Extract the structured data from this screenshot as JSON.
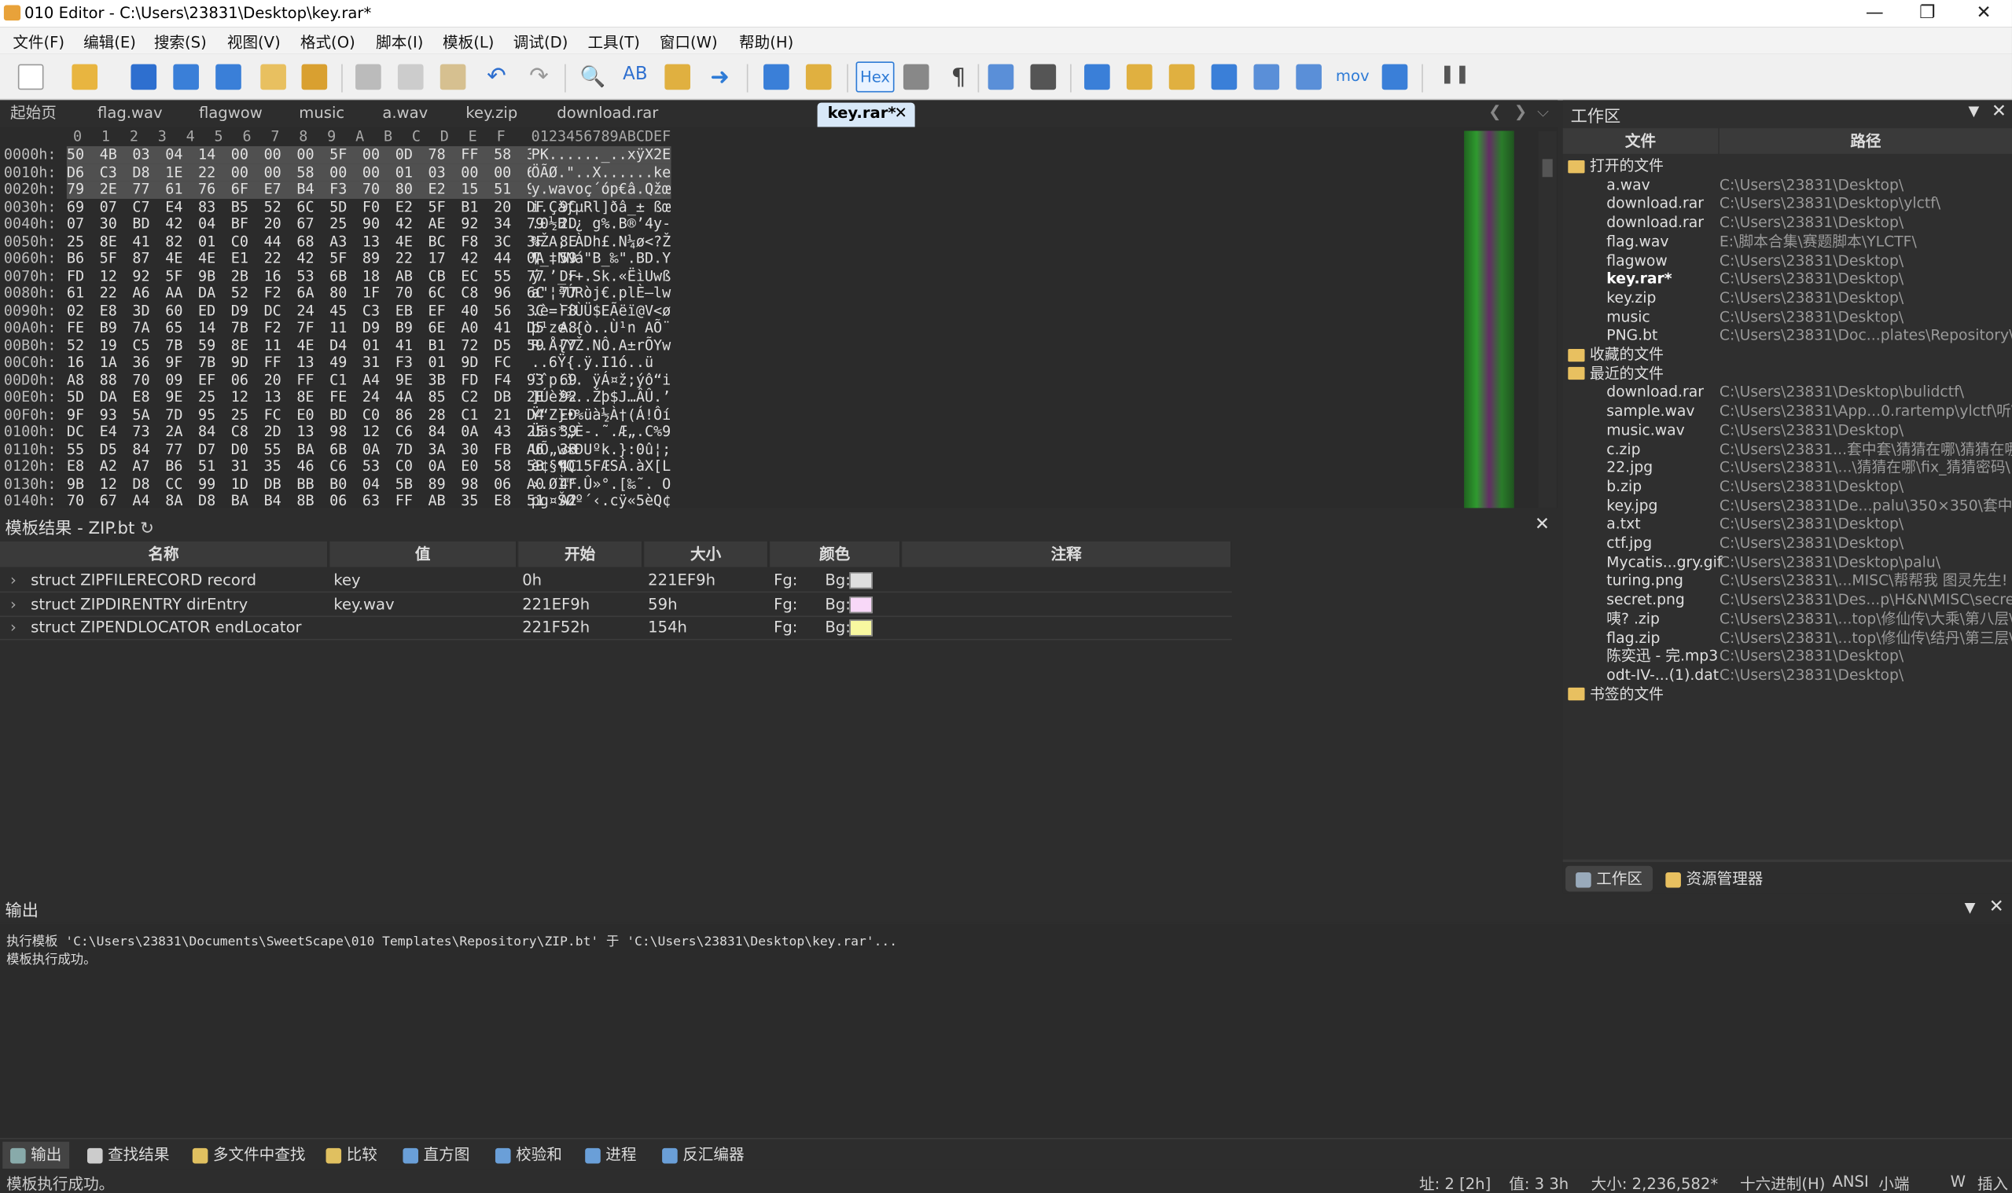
{
  "window": {
    "title": "010 Editor - C:\\Users\\23831\\Desktop\\key.rar*"
  },
  "menu": [
    "文件(F)",
    "编辑(E)",
    "搜索(S)",
    "视图(V)",
    "格式(O)",
    "脚本(I)",
    "模板(L)",
    "调试(D)",
    "工具(T)",
    "窗口(W)",
    "帮助(H)"
  ],
  "toolbar": {
    "hex_label": "Hex",
    "mov_label": "mov",
    "icons": [
      "new-file-icon",
      "open-file-icon",
      "save-icon",
      "save-as-icon",
      "save-all-icon",
      "open-folder-icon",
      "workspace-icon",
      "cut-icon",
      "copy-icon",
      "paste-icon",
      "undo-icon",
      "redo-icon",
      "find-icon",
      "replace-icon",
      "find-in-files-icon",
      "goto-icon",
      "run-script-icon",
      "run-template-icon",
      "hex-mode-icon",
      "text-mode-icon",
      "paragraph-icon",
      "columns-icon",
      "highlight-icon",
      "calculator-icon",
      "inspector-icon",
      "compare-icon",
      "histogram-icon",
      "checksum-icon",
      "checksum-ok-icon",
      "disassembler-icon",
      "base-convert-icon",
      "pause-icon"
    ]
  },
  "tabs": [
    "起始页",
    "flag.wav",
    "flagwow",
    "music",
    "a.wav",
    "key.zip",
    "download.rar",
    "key.rar*"
  ],
  "hex": {
    "header_cols": [
      "0",
      "1",
      "2",
      "3",
      "4",
      "5",
      "6",
      "7",
      "8",
      "9",
      "A",
      "B",
      "C",
      "D",
      "E",
      "F"
    ],
    "ascii_header": "0123456789ABCDEF",
    "rows": [
      {
        "off": "0000h:",
        "bytes": "50 4B 03 04 14 00 00 00 5F 00 0D 78 FF 58 32 45",
        "ascii": "PK......_..xÿX2E"
      },
      {
        "off": "0010h:",
        "bytes": "D6 C3 D8 1E 22 00 00 58 00 00 01 03 00 00 6B 65",
        "ascii": "ÖÃØ.\"..X......ke"
      },
      {
        "off": "0020h:",
        "bytes": "79 2E 77 61 76 6F E7 B4 F3 70 80 E2 15 51 9E 9C",
        "ascii": "y.wavoç´óp€â.Qžœ"
      },
      {
        "off": "0030h:",
        "bytes": "69 07 C7 E4 83 B5 52 6C 5D F0 E2 5F B1 20 DF 9C",
        "ascii": "i.ÇäƒµRl]ðâ_± ßœ"
      },
      {
        "off": "0040h:",
        "bytes": "07 30 BD 42 04 BF 20 67 25 90 42 AE 92 34 79 2D",
        "ascii": ".0½B.¿ g%.B®’4y-"
      },
      {
        "off": "0050h:",
        "bytes": "25 8E 41 82 01 C0 44 68 A3 13 4E BC F8 3C 3F 8E",
        "ascii": "%ŽA‚.ÀDh£.N¼ø<?Ž"
      },
      {
        "off": "0060h:",
        "bytes": "B6 5F 87 4E 4E E1 22 42 5F 89 22 17 42 44 0A 59",
        "ascii": "¶_‡NNá\"B_‰\".BD.Y"
      },
      {
        "off": "0070h:",
        "bytes": "FD 12 92 5F 9B 2B 16 53 6B 18 AB CB EC 55 77 DF",
        "ascii": "ý.’_›+.Sk.«ËìUwß"
      },
      {
        "off": "0080h:",
        "bytes": "61 22 A6 AA DA 52 F2 6A 80 1F 70 6C C8 96 6C 77",
        "ascii": "a\"¦ªÚRòj€.plÈ–lw"
      },
      {
        "off": "0090h:",
        "bytes": "02 E8 3D 60 ED D9 DC 24 45 C3 EB EF 40 56 3C F8",
        "ascii": ".è=`íÙÜ$EÃëï@V<ø"
      },
      {
        "off": "00A0h:",
        "bytes": "FE B9 7A 65 14 7B F2 7F 11 D9 B9 6E A0 41 D5 A8",
        "ascii": "þ¹ze.{ò..Ù¹n AÕ¨"
      },
      {
        "off": "00B0h:",
        "bytes": "52 19 C5 7B 59 8E 11 4E D4 01 41 B1 72 D5 59 77",
        "ascii": "R.Å{YŽ.NÔ.A±rÕYw"
      },
      {
        "off": "00C0h:",
        "bytes": "16 1A 36 9F 7B 9D FF 13 49 31 F3 01 9D FC",
        "ascii": "..6Ÿ{.ÿ.I1ó..ü"
      },
      {
        "off": "00D0h:",
        "bytes": "A8 88 70 09 EF 06 20 FF C1 A4 9E 3B FD F4 93 69",
        "ascii": "¨ˆp.ï. ÿÁ¤ž;ýô“i"
      },
      {
        "off": "00E0h:",
        "bytes": "5D DA E8 9E 25 12 13 8E FE 24 4A 85 C2 DB 2E 92",
        "ascii": "]Úèž%..Žþ$J…ÂÛ.’"
      },
      {
        "off": "00F0h:",
        "bytes": "9F 93 5A 7D 95 25 FC E0 BD C0 86 28 C1 21 D4 ED",
        "ascii": "Ÿ“Z}•%üà½À†(Á!Ôí"
      },
      {
        "off": "0100h:",
        "bytes": "DC E4 73 2A 84 C8 2D 13 98 12 C6 84 0A 43 25 39",
        "ascii": "Üäs*„È-.˜.Æ„.C%9"
      },
      {
        "off": "0110h:",
        "bytes": "55 D5 84 77 D7 D0 55 BA 6B 0A 7D 3A 30 FB A6 3B",
        "ascii": "UÕ„w×ÐUºk.}:0û¦;"
      },
      {
        "off": "0120h:",
        "bytes": "E8 A2 A7 B6 51 31 35 46 C6 53 C0 0A E0 58 5B 4C",
        "ascii": "è¢§¶Q15FÆSÀ.àX[L"
      },
      {
        "off": "0130h:",
        "bytes": "9B 12 D8 CC 99 1D DB BB B0 04 5B 89 98 06 A0 4F",
        "ascii": "›.ØÌ™.Û»°.[‰˜. O"
      },
      {
        "off": "0140h:",
        "bytes": "70 67 A4 8A D8 BA B4 8B 06 63 FF AB 35 E8 51 A2",
        "ascii": "pg¤ŠØº´‹.cÿ«5èQ¢"
      }
    ]
  },
  "template": {
    "title": "模板结果 - ZIP.bt",
    "columns": [
      "名称",
      "值",
      "开始",
      "大小",
      "颜色",
      "注释"
    ],
    "rows": [
      {
        "name": "struct ZIPFILERECORD record",
        "value": "key",
        "start": "0h",
        "size": "221EF9h",
        "fg": "Fg:",
        "bg": "Bg:",
        "bgcolor": "#dedede"
      },
      {
        "name": "struct ZIPDIRENTRY dirEntry",
        "value": "key.wav",
        "start": "221EF9h",
        "size": "59h",
        "fg": "Fg:",
        "bg": "Bg:",
        "bgcolor": "#f8d8f8"
      },
      {
        "name": "struct ZIPENDLOCATOR endLocator",
        "value": "",
        "start": "221F52h",
        "size": "154h",
        "fg": "Fg:",
        "bg": "Bg:",
        "bgcolor": "#f8f8a0"
      }
    ]
  },
  "workspace": {
    "title": "工作区",
    "col_file": "文件",
    "col_path": "路径",
    "groups": {
      "open": "打开的文件",
      "fav": "收藏的文件",
      "recent": "最近的文件",
      "bookmark": "书签的文件"
    },
    "open_files": [
      {
        "name": "a.wav",
        "path": "C:\\Users\\23831\\Desktop\\"
      },
      {
        "name": "download.rar",
        "path": "C:\\Users\\23831\\Desktop\\ylctf\\"
      },
      {
        "name": "download.rar",
        "path": "C:\\Users\\23831\\Desktop\\"
      },
      {
        "name": "flag.wav",
        "path": "E:\\脚本合集\\赛题脚本\\YLCTF\\"
      },
      {
        "name": "flagwow",
        "path": "C:\\Users\\23831\\Desktop\\"
      },
      {
        "name": "key.rar*",
        "path": "C:\\Users\\23831\\Desktop\\"
      },
      {
        "name": "key.zip",
        "path": "C:\\Users\\23831\\Desktop\\"
      },
      {
        "name": "music",
        "path": "C:\\Users\\23831\\Desktop\\"
      },
      {
        "name": "PNG.bt",
        "path": "C:\\Users\\23831\\Doc...plates\\Repository\\"
      }
    ],
    "recent_files": [
      {
        "name": "download.rar",
        "path": "C:\\Users\\23831\\Desktop\\bulidctf\\"
      },
      {
        "name": "sample.wav",
        "path": "C:\\Users\\23831\\App...0.rartemp\\ylctf\\听\\"
      },
      {
        "name": "music.wav",
        "path": "C:\\Users\\23831\\Desktop\\"
      },
      {
        "name": "c.zip",
        "path": "C:\\Users\\23831...套中套\\猜猜在哪\\猜猜在哪\\"
      },
      {
        "name": "22.jpg",
        "path": "C:\\Users\\23831\\...\\猜猜在哪\\fix_猜猜密码\\"
      },
      {
        "name": "b.zip",
        "path": "C:\\Users\\23831\\Desktop\\"
      },
      {
        "name": "key.jpg",
        "path": "C:\\Users\\23831\\De...palu\\350×350\\套中套\\"
      },
      {
        "name": "a.txt",
        "path": "C:\\Users\\23831\\Desktop\\"
      },
      {
        "name": "ctf.jpg",
        "path": "C:\\Users\\23831\\Desktop\\"
      },
      {
        "name": "Mycatis...gry.gif",
        "path": "C:\\Users\\23831\\Desktop\\palu\\"
      },
      {
        "name": "turing.png",
        "path": "C:\\Users\\23831\\...MISC\\帮帮我 图灵先生! \\"
      },
      {
        "name": "secret.png",
        "path": "C:\\Users\\23831\\Des...p\\H&N\\MISC\\secret\\"
      },
      {
        "name": "咦? .zip",
        "path": "C:\\Users\\23831\\...top\\修仙传\\大乘\\第八层\\"
      },
      {
        "name": "flag.zip",
        "path": "C:\\Users\\23831\\...top\\修仙传\\结丹\\第三层\\"
      },
      {
        "name": "陈奕迅 - 完.mp3",
        "path": "C:\\Users\\23831\\Desktop\\"
      },
      {
        "name": "odt-IV-...(1).dat",
        "path": "C:\\Users\\23831\\Desktop\\"
      }
    ],
    "tab_workspace": "工作区",
    "tab_explorer": "资源管理器"
  },
  "output": {
    "title": "输出",
    "lines": [
      "执行模板 'C:\\Users\\23831\\Documents\\SweetScape\\010 Templates\\Repository\\ZIP.bt' 于 'C:\\Users\\23831\\Desktop\\key.rar'...",
      "模板执行成功。"
    ]
  },
  "bottom_tabs": [
    "输出",
    "查找结果",
    "多文件中查找",
    "比较",
    "直方图",
    "校验和",
    "进程",
    "反汇编器"
  ],
  "status": {
    "message": "模板执行成功。",
    "addr": "址: 2 [2h]",
    "value": "值: 3 3h",
    "size": "大小: 2,236,582*",
    "mode": "十六进制(H)",
    "enc": "ANSI",
    "endian": "小端",
    "w": "W",
    "ins": "插入"
  }
}
